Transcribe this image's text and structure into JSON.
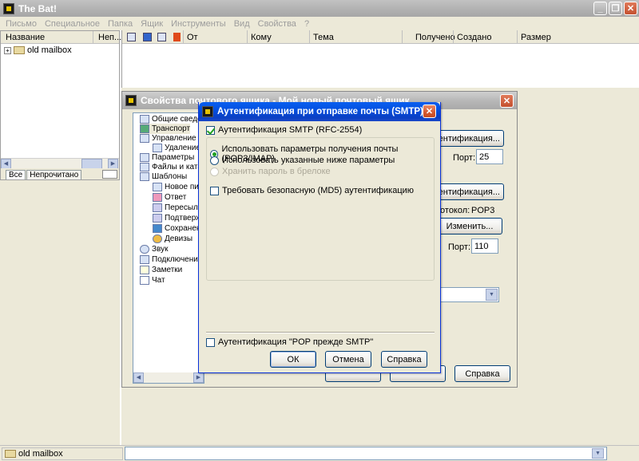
{
  "app": {
    "title": "The Bat!",
    "win_min": "_",
    "win_max": "❐",
    "win_close": "✕"
  },
  "menu": [
    "Письмо",
    "Специальное",
    "Папка",
    "Ящик",
    "Инструменты",
    "Вид",
    "Свойства",
    "?"
  ],
  "folder_pane": {
    "columns": [
      "Название",
      "Неп..."
    ],
    "items": [
      {
        "expander": "+",
        "label": "old mailbox"
      }
    ],
    "tabs": [
      "Все",
      "Непрочитано"
    ]
  },
  "message_list": {
    "columns": [
      "От",
      "Кому",
      "Тема",
      "Получено",
      "Создано",
      "Размер"
    ]
  },
  "statusbar": {
    "mailbox": "old mailbox"
  },
  "mailbox_properties_dialog": {
    "title": "Свойства почтового ящика - Мой новый почтовый ящик",
    "tree": [
      "Общие сведения",
      "Транспорт",
      "Управление почтой",
      "Удаление",
      "Параметры",
      "Файлы и каталоги",
      "Шаблоны",
      "Новое письмо",
      "Ответ",
      "Пересылка",
      "Подтверждение",
      "Сохранение",
      "Девизы",
      "Звук",
      "Подключение",
      "Заметки",
      "Чат"
    ],
    "smtp_auth_button": "Аутентификация...",
    "smtp_port_label": "Порт:",
    "smtp_port_value": "25",
    "pop_auth_button": "Аутентификация...",
    "protocol_label": "Протокол:",
    "protocol_value": "POP3",
    "change_button": "Изменить...",
    "pop_port_label": "Порт:",
    "pop_port_value": "110",
    "help_button": "Справка"
  },
  "smtp_auth_dialog": {
    "title": "Аутентификация при отправке почты (SMTP)",
    "smtp_auth_checkbox": {
      "label": "Аутентификация SMTP (RFC-2554)",
      "checked": true
    },
    "options": [
      {
        "label": "Использовать параметры получения почты (POP3/IMAP)",
        "selected": true,
        "disabled": false
      },
      {
        "label": "Использовать указанные ниже параметры",
        "selected": false,
        "disabled": false
      },
      {
        "label": "Хранить пароль в брелоке",
        "selected": false,
        "disabled": true
      }
    ],
    "md5_checkbox": {
      "label": "Требовать безопасную (MD5) аутентификацию",
      "checked": false
    },
    "pop_before_smtp_checkbox": {
      "label": "Аутентификация \"POP прежде SMTP\"",
      "checked": false
    },
    "ok_button": "ОК",
    "cancel_button": "Отмена",
    "help_button": "Справка"
  }
}
